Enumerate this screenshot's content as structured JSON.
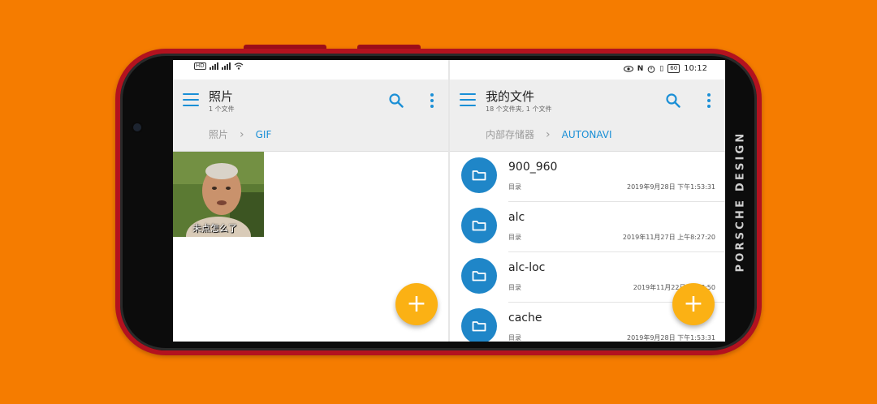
{
  "device": {
    "brand_text": "PORSCHE DESIGN"
  },
  "status_bar": {
    "time": "10:12",
    "battery": "60"
  },
  "left_pane": {
    "title": "照片",
    "subtitle": "1 个文件",
    "breadcrumb": [
      "照片",
      "GIF"
    ],
    "thumbnail": {
      "caption": "未点怎么了"
    },
    "fab_label": "+"
  },
  "right_pane": {
    "title": "我的文件",
    "subtitle": "18 个文件夹, 1 个文件",
    "breadcrumb": [
      "内部存储器",
      "AUTONAVI"
    ],
    "folders": [
      {
        "name": "900_960",
        "kind": "目录",
        "date": "2019年9月28日 下午1:53:31"
      },
      {
        "name": "alc",
        "kind": "目录",
        "date": "2019年11月27日 上午8:27:20"
      },
      {
        "name": "alc-loc",
        "kind": "目录",
        "date": "2019年11月22日 上午8:50"
      },
      {
        "name": "cache",
        "kind": "目录",
        "date": "2019年9月28日 下午1:53:31"
      }
    ],
    "fab_label": "+"
  },
  "colors": {
    "accent": "#1a8fd6",
    "folder": "#1f86c8",
    "fab": "#fbb114",
    "background": "#f57c00",
    "phone_frame": "#b3121f"
  }
}
